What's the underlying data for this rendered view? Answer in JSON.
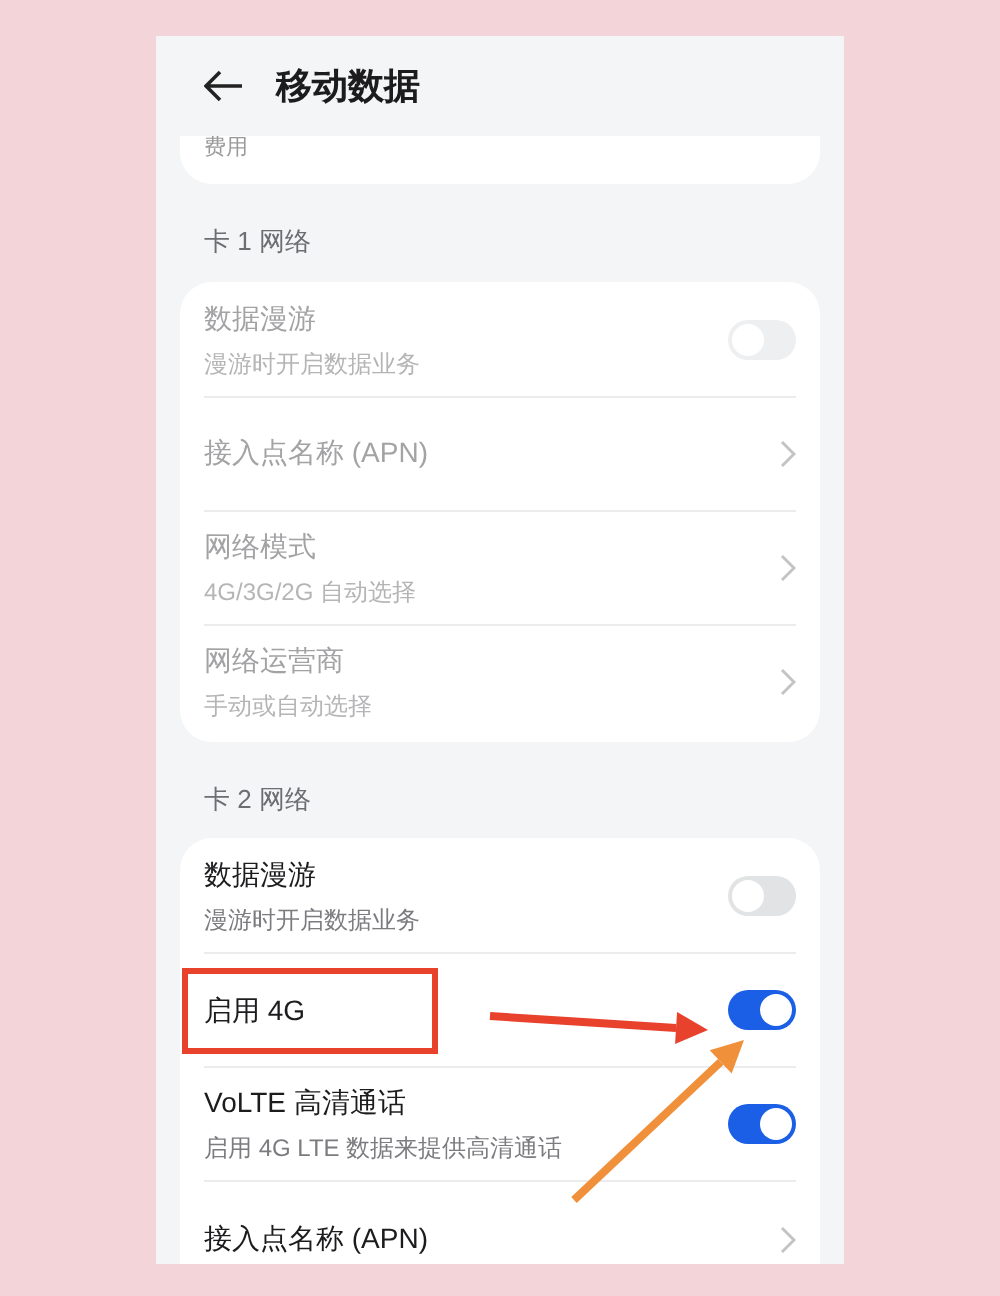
{
  "header": {
    "title": "移动数据"
  },
  "top_card": {
    "label": "费用"
  },
  "sections": [
    {
      "title": "卡 1 网络",
      "disabled": true,
      "items": [
        {
          "kind": "toggle",
          "title": "数据漫游",
          "subtitle": "漫游时开启数据业务",
          "on": false,
          "highlighted": false
        },
        {
          "kind": "link",
          "title": "接入点名称 (APN)",
          "highlighted": false
        },
        {
          "kind": "link",
          "title": "网络模式",
          "subtitle": "4G/3G/2G 自动选择",
          "highlighted": false
        },
        {
          "kind": "link",
          "title": "网络运营商",
          "subtitle": "手动或自动选择",
          "highlighted": false
        }
      ]
    },
    {
      "title": "卡 2 网络",
      "disabled": false,
      "items": [
        {
          "kind": "toggle",
          "title": "数据漫游",
          "subtitle": "漫游时开启数据业务",
          "on": false,
          "highlighted": false
        },
        {
          "kind": "toggle",
          "title": "启用 4G",
          "on": true,
          "highlighted": true
        },
        {
          "kind": "toggle",
          "title": "VoLTE 高清通话",
          "subtitle": "启用 4G LTE 数据来提供高清通话",
          "on": true,
          "highlighted": false
        },
        {
          "kind": "link",
          "title": "接入点名称 (APN)",
          "highlighted": false
        }
      ]
    }
  ],
  "annotations": [
    {
      "kind": "arrow",
      "color": "#e8412c"
    },
    {
      "kind": "arrow",
      "color": "#f0903a"
    }
  ]
}
